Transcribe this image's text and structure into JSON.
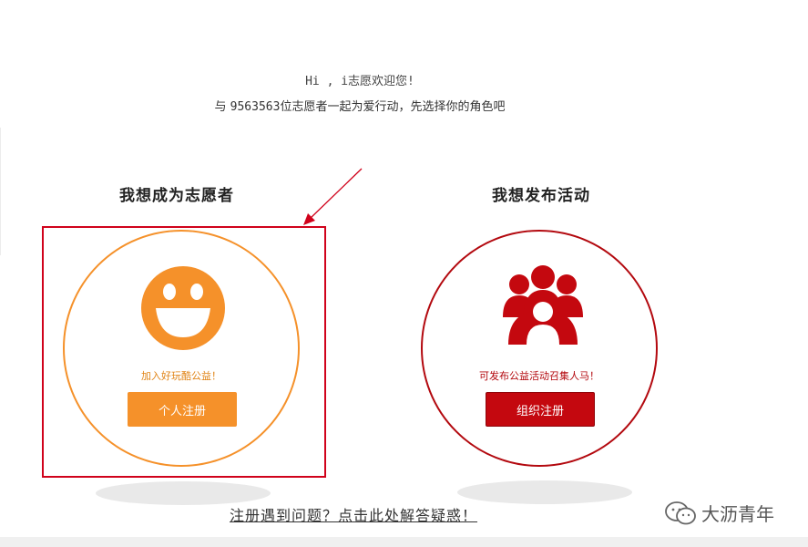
{
  "header": {
    "greeting": "Hi , i志愿欢迎您!",
    "sub_prefix": "与 ",
    "volunteer_count": "9563563",
    "sub_suffix": "位志愿者一起为爱行动，先选择你的角色吧"
  },
  "roles": [
    {
      "heading": "我想成为志愿者",
      "icon": "smiley-face-icon",
      "tagline": "加入好玩酷公益！",
      "button_label": "个人注册",
      "color": "#f5912a"
    },
    {
      "heading": "我想发布活动",
      "icon": "group-people-icon",
      "tagline": "可发布公益活动召集人马！",
      "button_label": "组织注册",
      "color": "#c4080f"
    }
  ],
  "help_link": "注册遇到问题？点击此处解答疑惑！",
  "watermark": {
    "icon": "wechat-icon",
    "text": "大沥青年"
  },
  "colors": {
    "highlight": "#d0021b",
    "orange": "#f5912a",
    "red": "#c4080f"
  }
}
